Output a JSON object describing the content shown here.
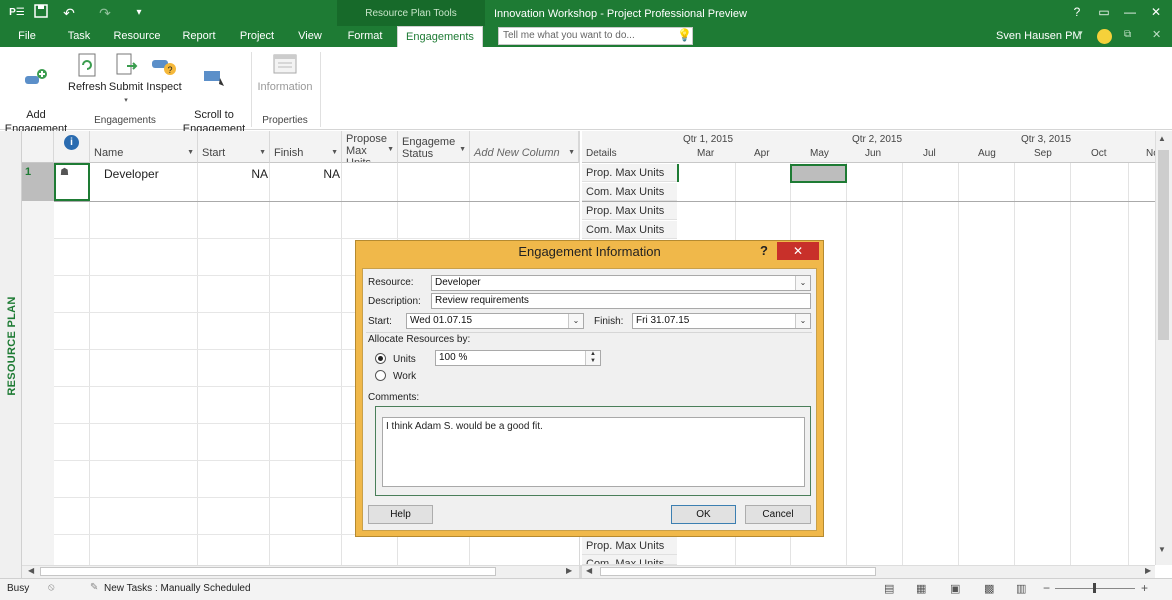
{
  "app": {
    "contextual_tools": "Resource Plan Tools",
    "document_title": "Innovation Workshop - Project Professional Preview",
    "help": "?",
    "user": "Sven Hausen PM",
    "user_dropdown": "▾"
  },
  "quick_access": {
    "app_icon": "P☑",
    "save_icon": "save",
    "undo_icon": "undo",
    "redo_icon": "redo"
  },
  "tabs": [
    "File",
    "Task",
    "Resource",
    "Report",
    "Project",
    "View",
    "Format",
    "Engagements"
  ],
  "tell_me": {
    "placeholder": "Tell me what you want to do..."
  },
  "ribbon": {
    "add_engagement": "Add\nEngagement",
    "refresh": "Refresh",
    "submit": "Submit",
    "inspect": "Inspect",
    "scroll_to": "Scroll to\nEngagement",
    "information": "Information",
    "group_engagements": "Engagements",
    "group_properties": "Properties"
  },
  "view_label": "RESOURCE PLAN",
  "grid": {
    "headers": {
      "info": "i",
      "name": "Name",
      "start": "Start",
      "finish": "Finish",
      "proposed": "Propose\nMax\nUnits",
      "status": "Engageme\nStatus",
      "add_col": "Add New Column"
    },
    "row": {
      "id": "1",
      "name": "Developer",
      "start": "NA",
      "finish": "NA"
    }
  },
  "timephased": {
    "details_header": "Details",
    "quarters": [
      "Qtr 1, 2015",
      "Qtr 2, 2015",
      "Qtr 3, 2015"
    ],
    "months": [
      "Mar",
      "Apr",
      "May",
      "Jun",
      "Jul",
      "Aug",
      "Sep",
      "Oct",
      "No"
    ],
    "row_labels": [
      "Prop. Max Units",
      "Com. Max Units",
      "Prop. Max Units",
      "Com. Max Units"
    ],
    "bottom_labels": [
      "Prop. Max Units",
      "Com. Max Units"
    ]
  },
  "dialog": {
    "title": "Engagement Information",
    "help_glyph": "?",
    "resource_label": "Resource:",
    "resource_value": "Developer",
    "description_label": "Description:",
    "description_value": "Review requirements",
    "start_label": "Start:",
    "start_value": "Wed 01.07.15",
    "finish_label": "Finish:",
    "finish_value": "Fri 31.07.15",
    "allocate_label": "Allocate Resources by:",
    "units_label": "Units",
    "units_value": "100 %",
    "work_label": "Work",
    "comments_label": "Comments:",
    "comments_value": "I think Adam S. would be a good fit.",
    "help_button": "Help",
    "ok_button": "OK",
    "cancel_button": "Cancel"
  },
  "status": {
    "mode": "Busy",
    "new_tasks": "New Tasks : Manually Scheduled"
  },
  "colors": {
    "accent": "#1e7b34",
    "dialog_frame": "#f0b84a",
    "close": "#c8302a"
  }
}
